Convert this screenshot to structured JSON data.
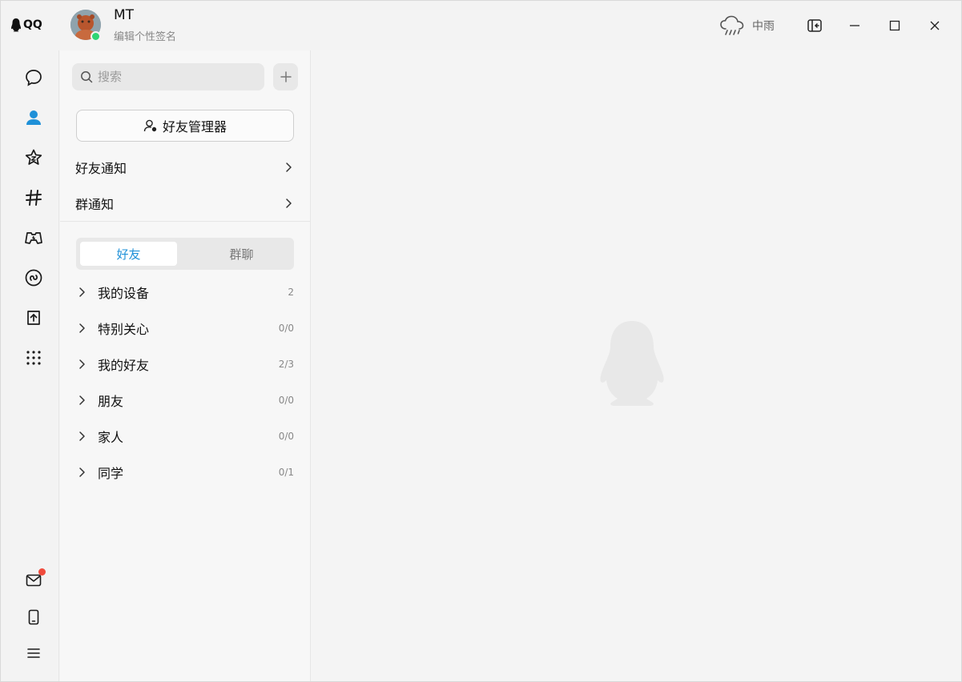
{
  "app": {
    "logo_text": "QQ"
  },
  "user": {
    "name": "MT",
    "signature": "编辑个性签名",
    "status_color": "#2ed573"
  },
  "weather": {
    "text": "中雨",
    "icon": "cloud-rain-icon"
  },
  "window_controls": {
    "icons": [
      "sidebar-toggle-icon",
      "minimize-icon",
      "maximize-icon",
      "close-icon"
    ]
  },
  "nav": {
    "items": [
      {
        "name": "messages",
        "icon": "chat-bubble-icon"
      },
      {
        "name": "contacts",
        "icon": "person-icon",
        "active": true
      },
      {
        "name": "favorites",
        "icon": "star-icon"
      },
      {
        "name": "channels",
        "icon": "hash-icon"
      },
      {
        "name": "games",
        "icon": "gamepad-icon"
      },
      {
        "name": "mini-programs",
        "icon": "link-icon"
      },
      {
        "name": "upload",
        "icon": "upload-icon"
      },
      {
        "name": "more-apps",
        "icon": "grid-dots-icon"
      }
    ],
    "bottom": [
      {
        "name": "mail",
        "icon": "mail-icon",
        "badge": true
      },
      {
        "name": "phone",
        "icon": "phone-icon"
      },
      {
        "name": "menu",
        "icon": "menu-icon"
      }
    ],
    "accent_color": "#1e90d8",
    "badge_color": "#f04b3c"
  },
  "search": {
    "placeholder": "搜索"
  },
  "friend_manager": {
    "label": "好友管理器"
  },
  "notices": [
    {
      "label": "好友通知"
    },
    {
      "label": "群通知"
    }
  ],
  "tabs": {
    "friends": "好友",
    "groups": "群聊"
  },
  "groups": [
    {
      "name": "我的设备",
      "count": "2"
    },
    {
      "name": "特别关心",
      "count": "0/0"
    },
    {
      "name": "我的好友",
      "count": "2/3"
    },
    {
      "name": "朋友",
      "count": "0/0"
    },
    {
      "name": "家人",
      "count": "0/0"
    },
    {
      "name": "同学",
      "count": "0/1"
    }
  ]
}
